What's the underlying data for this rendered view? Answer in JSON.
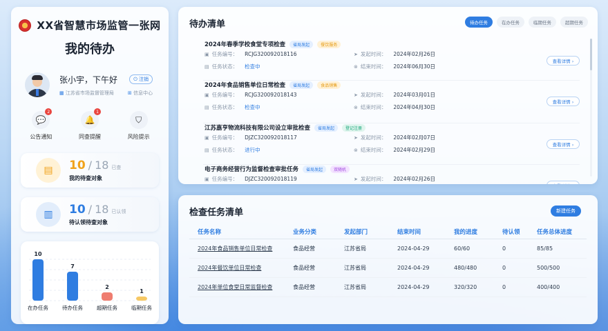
{
  "app": {
    "brand_title": "XX省智慧市场监管一张网",
    "page_title": "我的待办"
  },
  "user": {
    "name": "张小宇，下午好",
    "logout": "注销",
    "org": "江苏省市场监督管理局",
    "message_center": "信息中心"
  },
  "shortcuts": [
    {
      "label": "公告通知",
      "icon": "chat-icon",
      "badge": "2"
    },
    {
      "label": "同查提醒",
      "icon": "bell-icon",
      "badge": "1"
    },
    {
      "label": "风险提示",
      "icon": "shield-icon",
      "badge": ""
    }
  ],
  "stats": [
    {
      "value": "10",
      "sep": "/",
      "total": "18",
      "unit": "已查",
      "label": "我的待查对象",
      "color": "#f0a21b"
    },
    {
      "value": "10",
      "sep": "/",
      "total": "18",
      "unit": "已认领",
      "label": "待认领待查对象",
      "color": "#2f7de1"
    }
  ],
  "chart_data": {
    "type": "bar",
    "categories": [
      "在办任务",
      "待办任务",
      "超期任务",
      "临期任务"
    ],
    "values": [
      10,
      7,
      2,
      1
    ],
    "colors": [
      "#2f7de1",
      "#2f7de1",
      "#ef7d70",
      "#f6c864"
    ],
    "ylim": [
      0,
      10
    ],
    "grid": true
  },
  "todo": {
    "title": "待办清单",
    "filters": [
      "待办任务",
      "在办任务",
      "临期任务",
      "超期任务"
    ],
    "active_filter": 0,
    "field_labels": {
      "task_no": "任务编号：",
      "status": "任务状态：",
      "start": "发起时间：",
      "end": "结束时间："
    },
    "detail_label": "查看详情 ›",
    "tasks": [
      {
        "title": "2024年春季学校食堂专项检查",
        "tags": [
          {
            "text": "省局发起",
            "color": "blue"
          },
          {
            "text": "餐饮服务",
            "color": "orange"
          }
        ],
        "task_no": "RCJG320092018116",
        "status": "检查中",
        "start": "2024年02月26日",
        "end": "2024年06月30日"
      },
      {
        "title": "2024年食品销售单位日常检查",
        "tags": [
          {
            "text": "省局发起",
            "color": "blue"
          },
          {
            "text": "食品销售",
            "color": "orange"
          }
        ],
        "task_no": "RCJG320092018143",
        "status": "检查中",
        "start": "2024年03月01日",
        "end": "2024年04月30日"
      },
      {
        "title": "江苏嘉亨物流科技有限公司设立审批检查",
        "tags": [
          {
            "text": "省局发起",
            "color": "blue"
          },
          {
            "text": "登记注册",
            "color": "green"
          }
        ],
        "task_no": "DJZC320092018117",
        "status": "进行中",
        "start": "2024年02月07日",
        "end": "2024年02月29日"
      },
      {
        "title": "电子商务经营行为监督检查审批任务",
        "tags": [
          {
            "text": "省局发起",
            "color": "blue"
          },
          {
            "text": "双随机",
            "color": "purple"
          }
        ],
        "task_no": "DJZC320092018119",
        "status": "",
        "start": "2024年02月26日",
        "end": ""
      }
    ]
  },
  "inspect": {
    "title": "检查任务清单",
    "new_button": "新建任务",
    "columns": [
      "任务名称",
      "业务分类",
      "发起部门",
      "结束时间",
      "我的进度",
      "待认领",
      "任务总体进度"
    ],
    "rows": [
      [
        "2024年食品销售单位日常检查",
        "食品经营",
        "江苏省局",
        "2024-04-29",
        "60/60",
        "0",
        "85/85"
      ],
      [
        "2024年餐饮单位日常检查",
        "食品经营",
        "江苏省局",
        "2024-04-29",
        "480/480",
        "0",
        "500/500"
      ],
      [
        "2024年单位食堂日常监督检查",
        "食品经营",
        "江苏省局",
        "2024-04-29",
        "320/320",
        "0",
        "400/400"
      ]
    ]
  }
}
